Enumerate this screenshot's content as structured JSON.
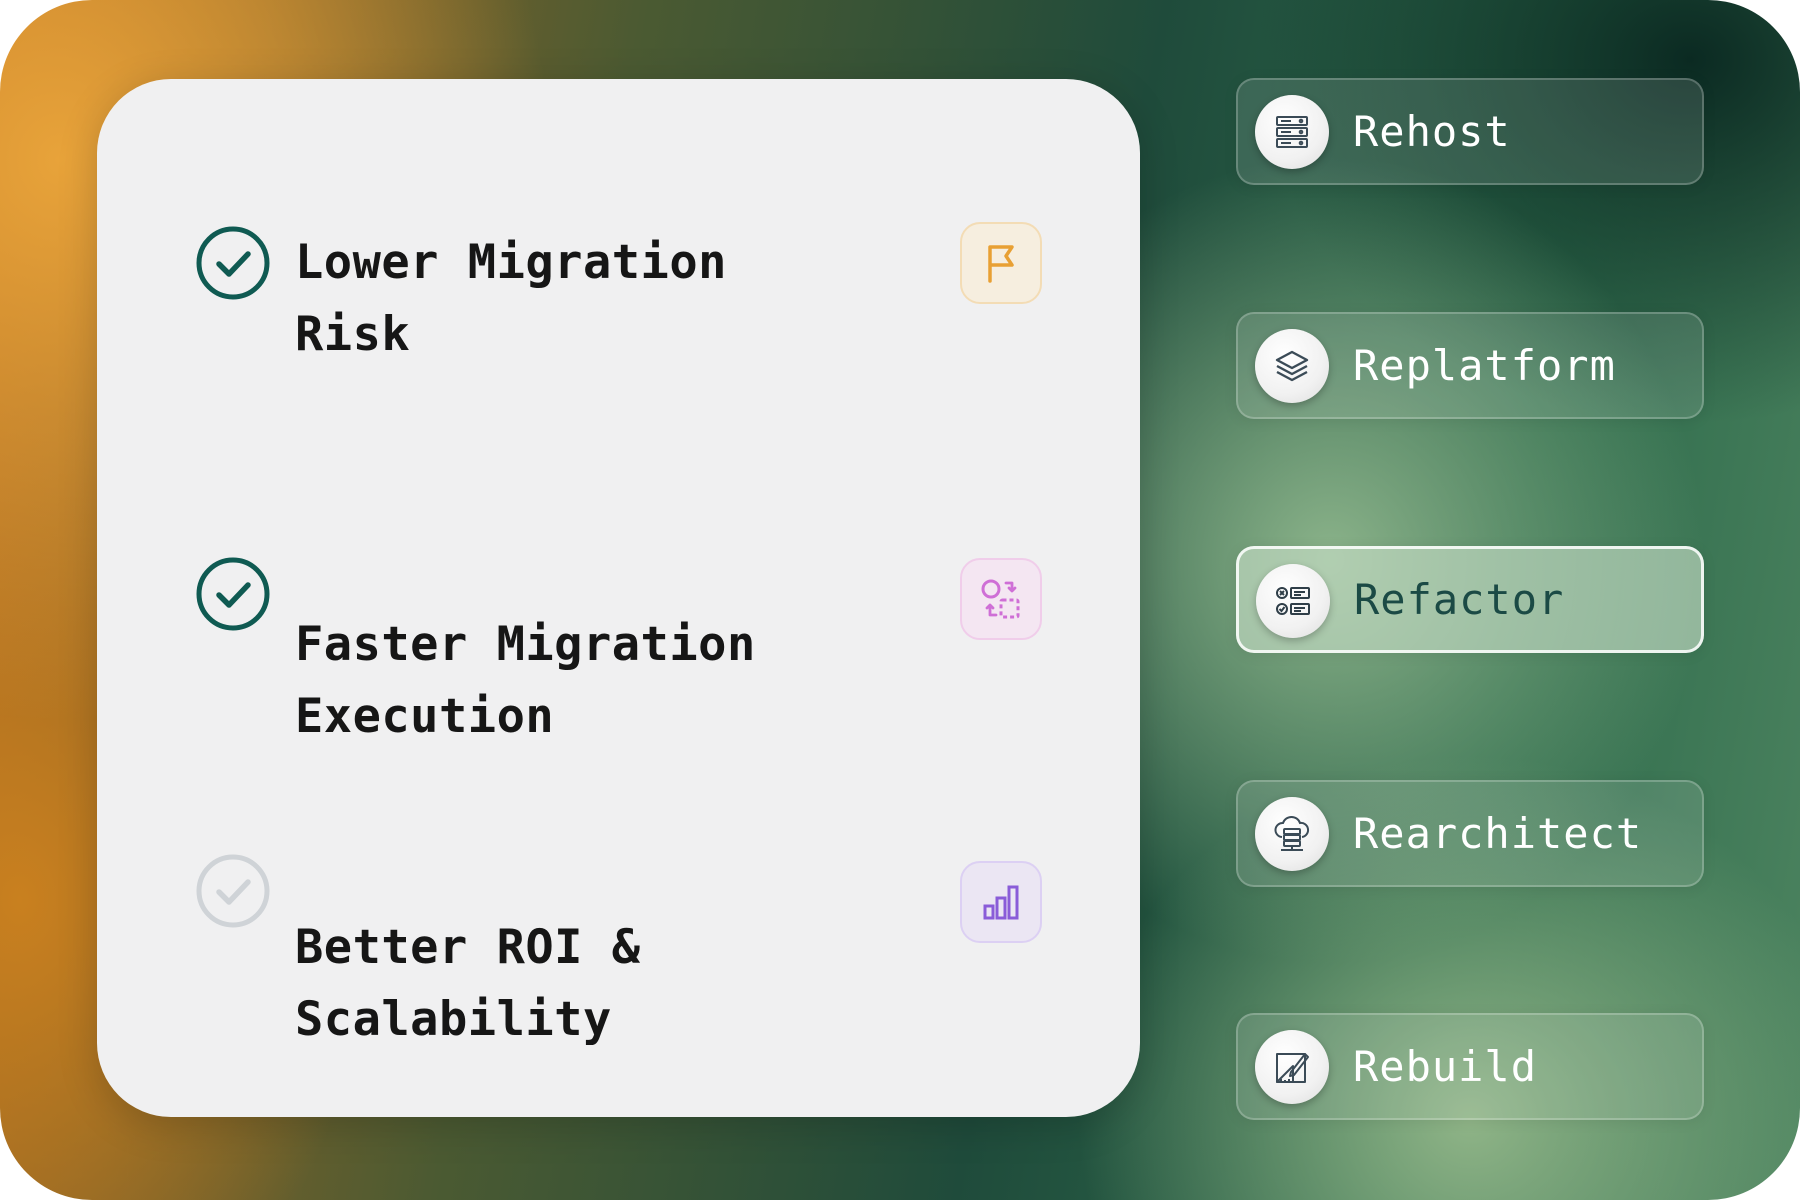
{
  "benefits": [
    {
      "label_lines": [
        "Lower Migration Risk"
      ],
      "checked": true,
      "icon": "flag-icon",
      "accent": "#e8a034"
    },
    {
      "label_lines": [
        "Faster Migration",
        "Execution"
      ],
      "checked": true,
      "icon": "shapes-swap-icon",
      "accent": "#cf6fd6"
    },
    {
      "label_lines": [
        "Better ROI &",
        "Scalability"
      ],
      "checked": false,
      "icon": "bar-chart-icon",
      "accent": "#8a5cd8"
    }
  ],
  "strategies": [
    {
      "label": "Rehost",
      "icon": "server-rack-icon",
      "selected": false
    },
    {
      "label": "Replatform",
      "icon": "layers-icon",
      "selected": false
    },
    {
      "label": "Refactor",
      "icon": "code-checklist-icon",
      "selected": true
    },
    {
      "label": "Rearchitect",
      "icon": "cloud-server-icon",
      "selected": false
    },
    {
      "label": "Rebuild",
      "icon": "blueprint-icon",
      "selected": false
    }
  ],
  "colors": {
    "check_active": "#0f5a52",
    "check_inactive": "#cfd3d7",
    "selected_text": "#1b4a45"
  }
}
